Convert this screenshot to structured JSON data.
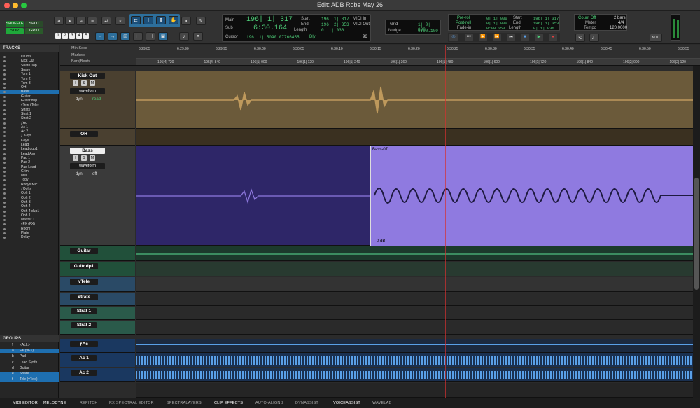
{
  "window": {
    "title": "Edit: ADB Robs May 26"
  },
  "edit_modes": {
    "shuffle": "SHUFFLE",
    "spot": "SPOT",
    "slip": "SLIP",
    "grid": "GRID"
  },
  "zoom_presets": [
    "1",
    "2",
    "3",
    "4",
    "5"
  ],
  "counter": {
    "main_label": "Main",
    "main_value": "196| 1| 317",
    "sub_label": "Sub",
    "sub_value": "6:30.164",
    "cursor_label": "Cursor",
    "cursor_value": "196| 1| 509",
    "cursor_db": "-0.07766455",
    "dly": "Dly",
    "start_label": "Start",
    "start_value": "196| 1| 317",
    "end_label": "End",
    "end_value": "196| 2| 353",
    "length_label": "Length",
    "length_value": "0| 1| 036",
    "midi_in": "MIDI In",
    "midi_out": "MIDI Out",
    "velocity": "96"
  },
  "grid": {
    "grid_label": "Grid",
    "grid_value": "1| 0| 000",
    "nudge_label": "Nudge",
    "nudge_value": "0:00.100"
  },
  "preroll": {
    "preroll_label": "Pre-roll",
    "preroll_value": "0| 1| 000",
    "postroll_label": "Post-roll",
    "postroll_value": "0| 1| 000",
    "fadein_label": "Fade-in",
    "fadein_value": "0:00.250",
    "start_label": "Start",
    "start_value": "196| 1| 317",
    "end_label": "End",
    "end_value": "196| 1| 353",
    "length_label": "Length",
    "length_value": "0| 1| 036"
  },
  "meter": {
    "countoff": "Count Off",
    "countoff_value": "2 bars",
    "meter_label": "Meter",
    "meter_value": "4/4",
    "tempo_label": "Tempo",
    "tempo_value": "120.0000",
    "mtc": "MTC"
  },
  "tracks_panel": {
    "header": "TRACKS",
    "items": [
      "Drums",
      "Kick Out",
      "Snare Top",
      "Snare",
      "Tom 1",
      "Tom 2",
      "Tom 3",
      "OH",
      "Bass",
      "Guitar",
      "Guitar.dup1",
      "vTele (Tele)",
      "Strats",
      "Strat 1",
      "Strat 2",
      "ƒAc",
      "Ac 1",
      "Ac 2",
      "ƒ Keys",
      "Keys",
      "Lead",
      "Lead.dup1",
      "Lead Arp",
      "Pad 1",
      "Pad 2",
      "Pad Lead",
      "Grim",
      "Mel",
      "Toby",
      "Robys Mic",
      "ƒOohs",
      "Ooh 1",
      "Ooh 2",
      "Ooh 3",
      "Ooh 4",
      "Ooh 4.dup1",
      "Ooh 1",
      "Master 1",
      "vFX (FX)",
      "Room",
      "Plate",
      "Delay"
    ],
    "selected": "Bass"
  },
  "groups_panel": {
    "header": "GROUPS",
    "items": [
      {
        "id": "!",
        "name": "<ALL>"
      },
      {
        "id": "a",
        "name": "FX (vFX)"
      },
      {
        "id": "b",
        "name": "Pad"
      },
      {
        "id": "c",
        "name": "Lead Synth"
      },
      {
        "id": "d",
        "name": "Guitar"
      },
      {
        "id": "e",
        "name": "Snare"
      },
      {
        "id": "f",
        "name": "Tele (vTele)"
      }
    ]
  },
  "rulers": {
    "minsecs_label": "Min:Secs",
    "markers_label": "Markers",
    "barsbeats_label": "Bars|Beats",
    "minsecs_ticks": [
      "6:29.85",
      "6:29.90",
      "6:29.95",
      "6:30.00",
      "6:30.05",
      "6:30.10",
      "6:30.15",
      "6:30.20",
      "6:30.25",
      "6:30.30",
      "6:30.35",
      "6:30.40",
      "6:30.45",
      "6:30.50",
      "6:30.55"
    ],
    "bars_ticks": [
      "195|4| 720",
      "195|4| 840",
      "196|1| 000",
      "196|1| 120",
      "196|1| 240",
      "196|1| 360",
      "196|1| 480",
      "196|1| 600",
      "196|1| 720",
      "196|1| 840",
      "196|2| 000",
      "196|2| 120"
    ]
  },
  "track_headers": {
    "kick": "Kick Out",
    "oh": "OH",
    "bass": "Bass",
    "guitar": "Guitar",
    "guitar_dup": "Guitr.dp1",
    "vtele": "vTele",
    "strats": "Strats",
    "strat1": "Strat 1",
    "strat2": "Strat 2",
    "fac": "ƒAc",
    "ac1": "Ac 1",
    "ac2": "Ac 2",
    "waveform": "waveform",
    "dyn": "dyn",
    "read": "read",
    "off": "off",
    "i": "I",
    "s": "S",
    "m": "M"
  },
  "clips": {
    "bass_clip_name": "Bass-07",
    "bass_clip_gain": "0 dB"
  },
  "bottom_tabs": [
    "MIDI EDITOR",
    "MELODYNE",
    "REPITCH",
    "RX SPECTRAL EDITOR",
    "SPECTRALAYERS",
    "CLIP EFFECTS",
    "AUTO-ALIGN 2",
    "DYNASSIST",
    "VOICEASSIST",
    "WAVELAB"
  ],
  "colors": {
    "kick": "#6b5a3a",
    "kick_wave": "#c8a060",
    "bass_dark": "#2e2668",
    "bass_light": "#8f7ae0",
    "guitar": "#21503a",
    "guitar_wave": "#4ab078",
    "strat": "#2a5a4a",
    "ac": "#1a3860",
    "ac_wave": "#5aa0e8"
  }
}
